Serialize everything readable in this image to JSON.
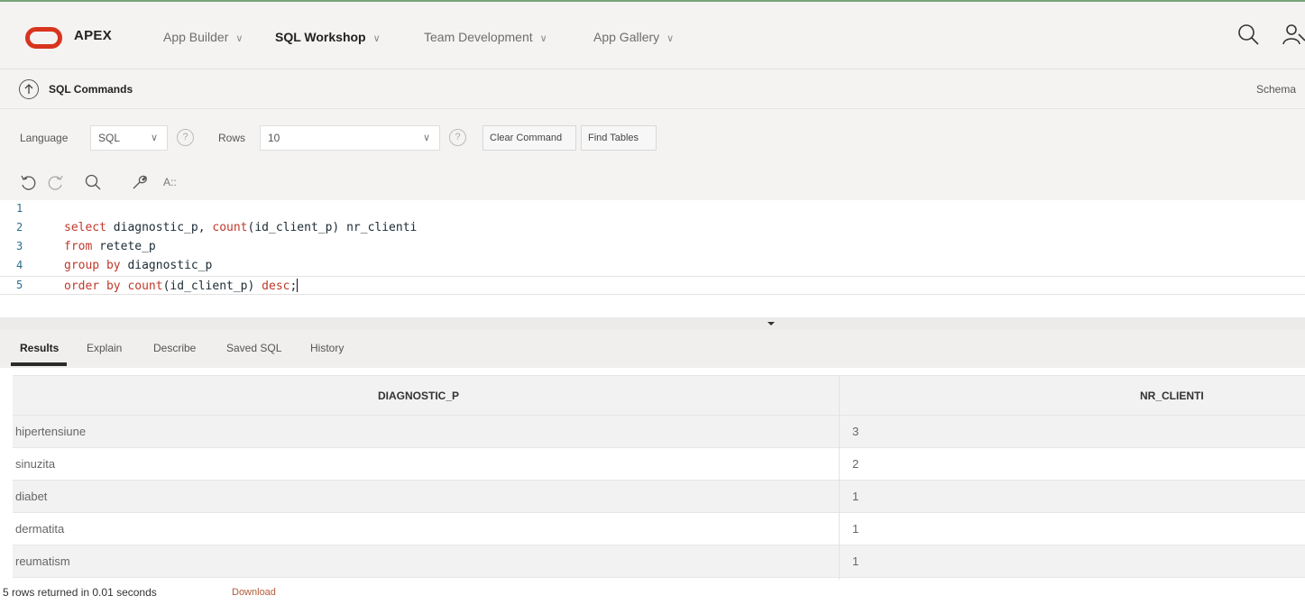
{
  "topnav": {
    "brand": "APEX",
    "items": [
      {
        "label": "App Builder",
        "active": false
      },
      {
        "label": "SQL Workshop",
        "active": true
      },
      {
        "label": "Team Development",
        "active": false
      },
      {
        "label": "App Gallery",
        "active": false
      }
    ],
    "caret": "∨",
    "icons": [
      "search-icon",
      "user-icon"
    ]
  },
  "page": {
    "title": "SQL Commands",
    "schema_label": "Schema"
  },
  "options": {
    "language_label": "Language",
    "language_value": "SQL",
    "rows_label": "Rows",
    "rows_value": "10",
    "help_glyph": "?",
    "clear_command": "Clear Command",
    "find_tables": "Find Tables"
  },
  "editor_toolbar": {
    "icons": [
      "undo-icon",
      "redo-icon",
      "search-icon",
      "wrench-icon",
      "format-icon"
    ],
    "format_label": "A::"
  },
  "editor": {
    "lines": [
      {
        "num": "1",
        "tokens": []
      },
      {
        "num": "2",
        "tokens": [
          {
            "t": "select",
            "k": true
          },
          {
            "t": " diagnostic_p, ",
            "k": false
          },
          {
            "t": "count",
            "k": true
          },
          {
            "t": "(id_client_p) nr_clienti",
            "k": false
          }
        ]
      },
      {
        "num": "3",
        "tokens": [
          {
            "t": "from",
            "k": true
          },
          {
            "t": " retete_p",
            "k": false
          }
        ]
      },
      {
        "num": "4",
        "tokens": [
          {
            "t": "group by",
            "k": true
          },
          {
            "t": " diagnostic_p",
            "k": false
          }
        ]
      },
      {
        "num": "5",
        "tokens": [
          {
            "t": "order by",
            "k": true
          },
          {
            "t": " ",
            "k": false
          },
          {
            "t": "count",
            "k": true
          },
          {
            "t": "(id_client_p) ",
            "k": false
          },
          {
            "t": "desc",
            "k": true
          },
          {
            "t": ";",
            "k": false
          }
        ]
      }
    ],
    "keyword_color": "#c0392b"
  },
  "tabs": [
    "Results",
    "Explain",
    "Describe",
    "Saved SQL",
    "History"
  ],
  "results": {
    "columns": [
      "DIAGNOSTIC_P",
      "NR_CLIENTI"
    ],
    "rows": [
      [
        "hipertensiune",
        "3"
      ],
      [
        "sinuzita",
        "2"
      ],
      [
        "diabet",
        "1"
      ],
      [
        "dermatita",
        "1"
      ],
      [
        "reumatism",
        "1"
      ]
    ],
    "status": "5 rows returned in 0.01 seconds",
    "download": "Download"
  },
  "colors": {
    "logo": "#d8341e",
    "download_link": "#b45b3b"
  }
}
